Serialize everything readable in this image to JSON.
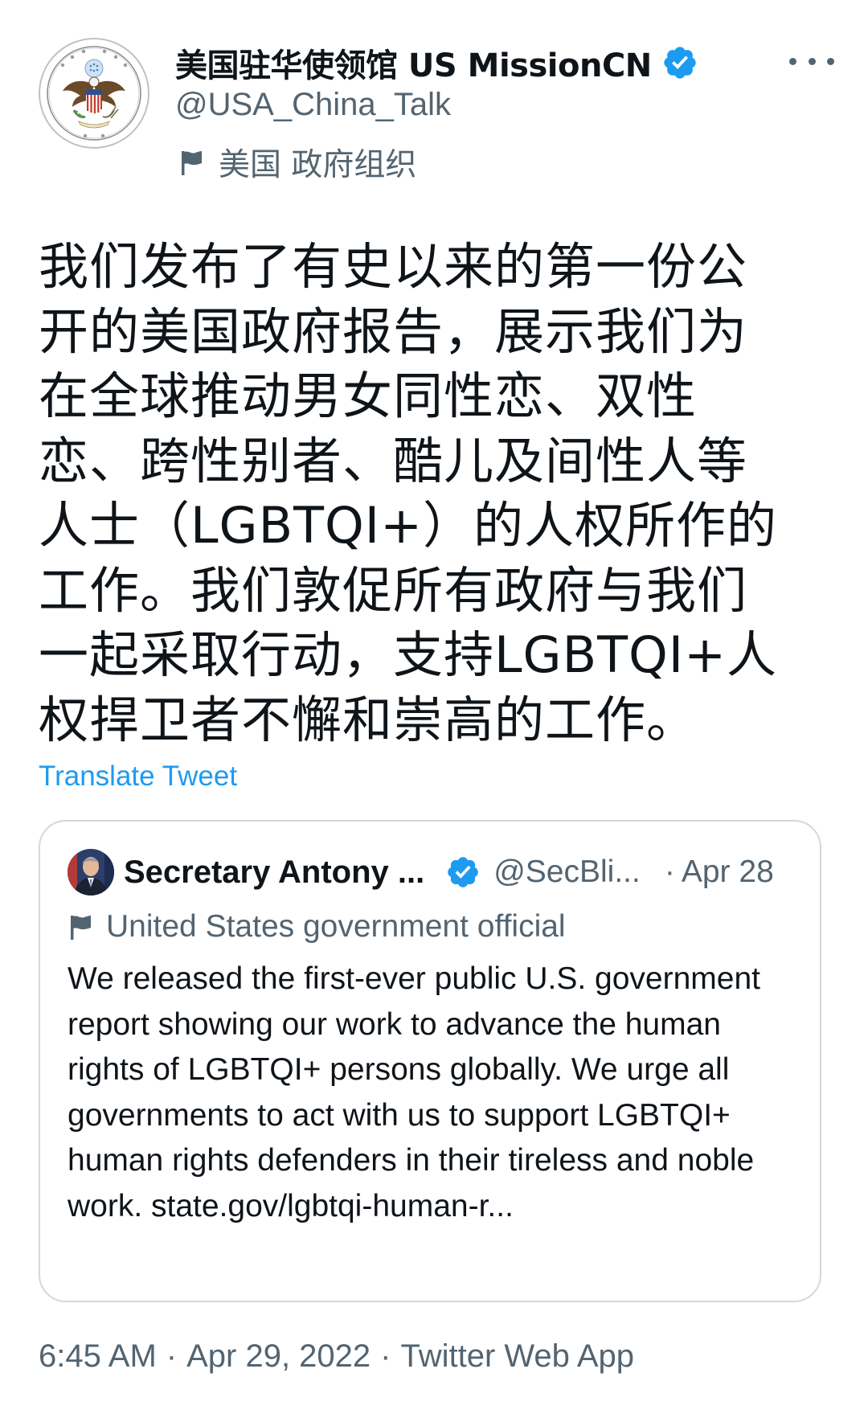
{
  "author": {
    "display_name": "美国驻华使领馆 US MissionCN",
    "handle": "@USA_China_Talk",
    "affiliation": "美国 政府组织",
    "verified": true
  },
  "tweet": {
    "text": "我们发布了有史以来的第一份公开的美国政府报告，展示我们为在全球推动男女同性恋、双性恋、跨性别者、酷儿及间性人等人士（LGBTQI+）的人权所作的工作。我们敦促所有政府与我们一起采取行动，支持LGBTQI+人权捍卫者不懈和崇高的工作。",
    "translate_label": "Translate Tweet"
  },
  "quoted_tweet": {
    "name": "Secretary Antony ...",
    "handle": "@SecBli...",
    "separator": "·",
    "date": "Apr 28",
    "affiliation": "United States government official",
    "text": "We released the first-ever public U.S. government report showing our work to advance the human rights of LGBTQI+ persons globally. We urge all governments to act with us to support LGBTQI+ human rights defenders in their tireless and noble work. state.gov/lgbtqi-human-r..."
  },
  "meta": {
    "time": "6:45 AM",
    "date": "Apr 29, 2022",
    "source": "Twitter Web App",
    "separator": "·"
  },
  "colors": {
    "text_primary": "#0f1419",
    "text_secondary": "#536471",
    "link": "#1d9bf0",
    "verified_badge": "#1d9bf0",
    "border": "#cfd9de"
  },
  "icons": {
    "verified": "verified-badge-icon",
    "more": "more-horizontal-icon",
    "affiliation": "flag-icon",
    "seal": "embassy-seal-avatar"
  }
}
